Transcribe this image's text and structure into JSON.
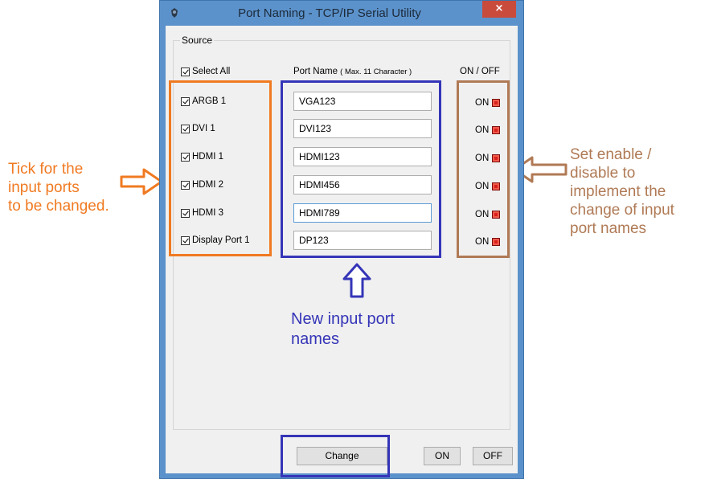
{
  "window": {
    "title": "Port Naming - TCP/IP Serial Utility",
    "close_label": "×"
  },
  "source": {
    "group_label": "Source",
    "select_all_label": "Select All",
    "select_all_checked": true,
    "port_name_header": "Port Name",
    "port_name_hint": "( Max. 11 Character )",
    "onoff_header": "ON / OFF",
    "ports": [
      {
        "label": "ARGB 1",
        "checked": true,
        "value": "VGA123",
        "status": "ON"
      },
      {
        "label": "DVI 1",
        "checked": true,
        "value": "DVI123",
        "status": "ON"
      },
      {
        "label": "HDMI 1",
        "checked": true,
        "value": "HDMI123",
        "status": "ON"
      },
      {
        "label": "HDMI 2",
        "checked": true,
        "value": "HDMI456",
        "status": "ON"
      },
      {
        "label": "HDMI 3",
        "checked": true,
        "value": "HDMI789",
        "status": "ON"
      },
      {
        "label": "Display Port 1",
        "checked": true,
        "value": "DP123",
        "status": "ON"
      }
    ]
  },
  "buttons": {
    "change": "Change",
    "on": "ON",
    "off": "OFF"
  },
  "annotations": {
    "left_text": [
      "Tick for the",
      "input ports",
      "to be changed."
    ],
    "center_text": [
      "New input port",
      "names"
    ],
    "right_text": [
      "Set enable /",
      "disable to",
      "implement the",
      "change of input",
      "port names"
    ]
  },
  "colors": {
    "annotation_orange": "#f07a21",
    "annotation_blue": "#3535b8",
    "annotation_brown": "#b07a55",
    "led_red": "#d9201d",
    "window_frame": "#5c92cb"
  }
}
